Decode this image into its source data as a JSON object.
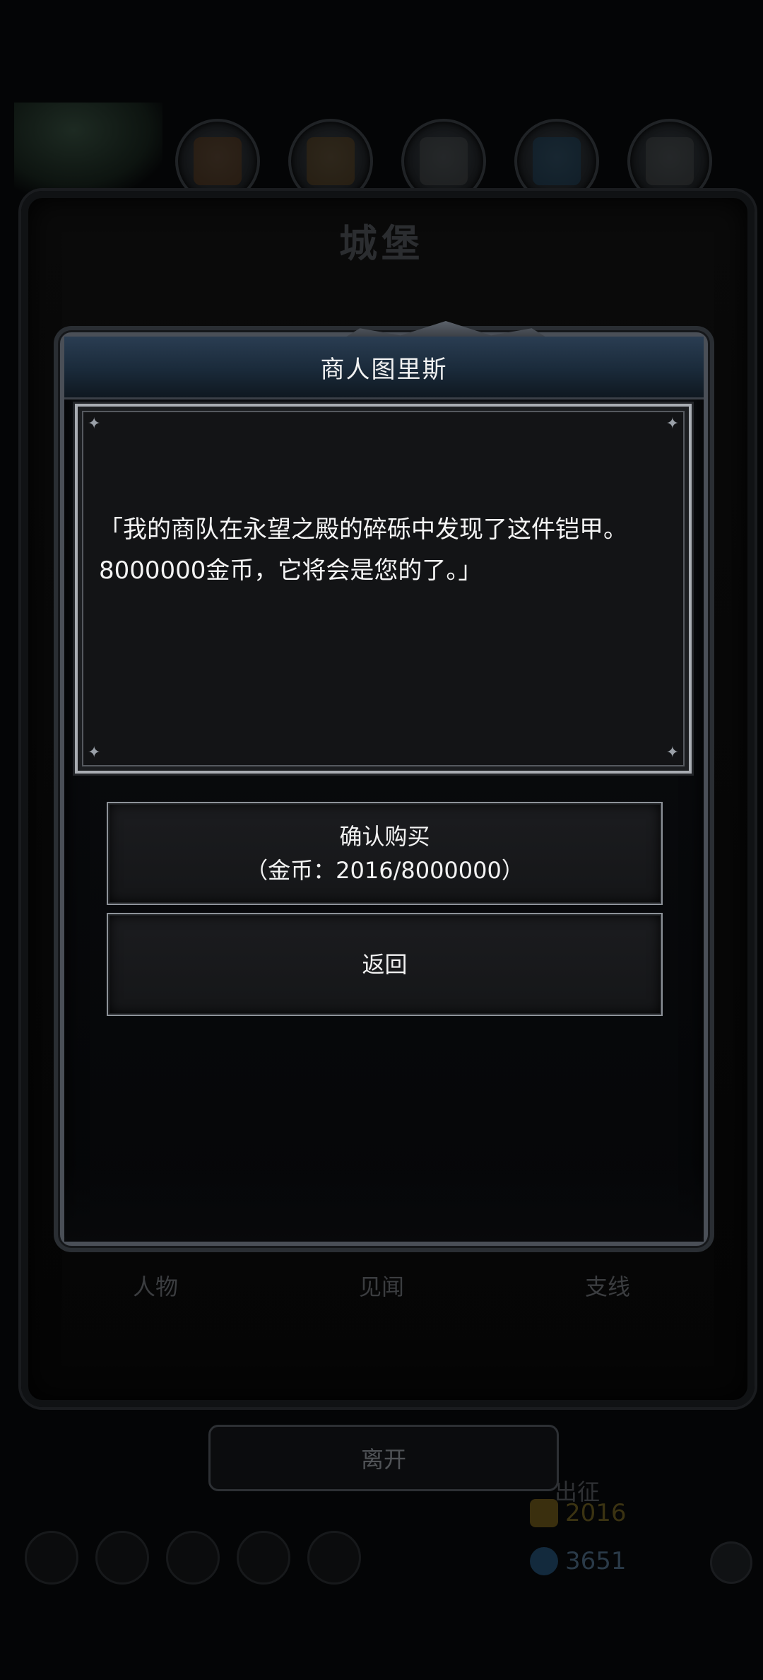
{
  "background": {
    "castle_title": "城堡",
    "tabs": [
      "人物",
      "见闻",
      "支线"
    ],
    "leave_label": "离开",
    "resource_label": "出征",
    "gold_amount": "2016",
    "gem_amount": "3651"
  },
  "dialog": {
    "title": "商人图里斯",
    "message": "「我的商队在永望之殿的碎砾中发现了这件铠甲。8000000金币，它将会是您的了。」",
    "confirm": {
      "label": "确认购买",
      "detail": "（金币：2016/8000000）"
    },
    "back_label": "返回"
  },
  "colors": {
    "header_blue": "#2a3d52",
    "panel_bg": "#131416",
    "frame_silver": "#a9adb3"
  }
}
